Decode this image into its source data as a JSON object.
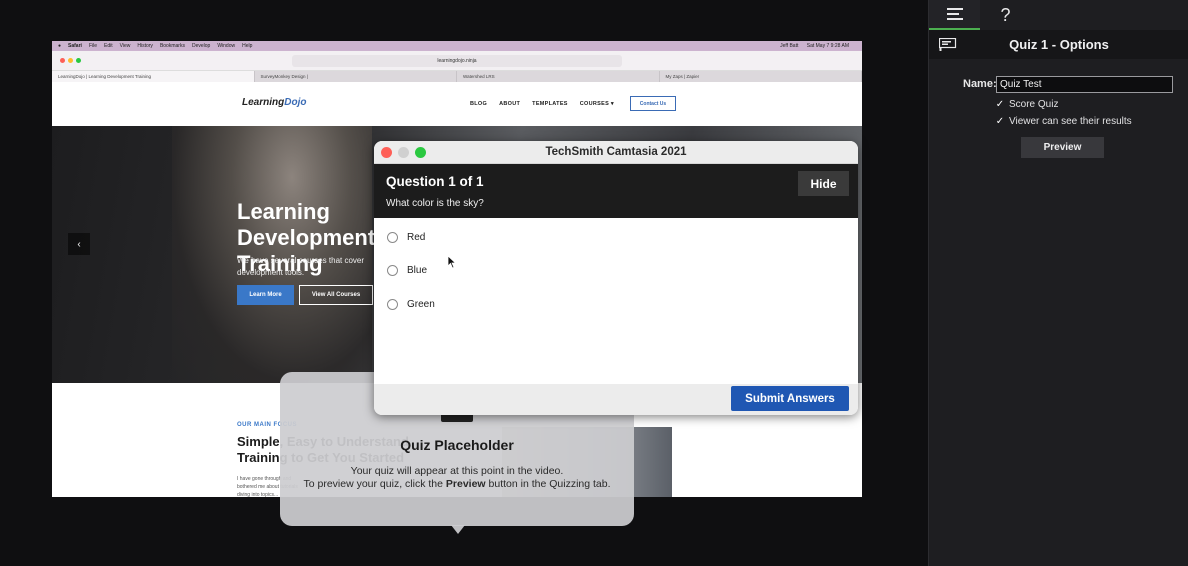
{
  "props_panel": {
    "tabs": [
      {
        "name": "properties",
        "glyph": "≡"
      },
      {
        "name": "help",
        "glyph": "?"
      }
    ],
    "header_title": "Quiz 1 - Options",
    "name_label": "Name:",
    "name_value": "Quiz Test",
    "checkboxes": [
      {
        "label": "Score Quiz",
        "checked": true
      },
      {
        "label": "Viewer can see their results",
        "checked": true
      }
    ],
    "preview_label": "Preview"
  },
  "browser": {
    "menubar": [
      "Safari",
      "File",
      "Edit",
      "View",
      "History",
      "Bookmarks",
      "Develop",
      "Window",
      "Help"
    ],
    "clock": "Sat May 7  9:28 AM",
    "user": "Jeff Batt",
    "address": "learningdojo.ninja",
    "tabs": [
      "LearningDojo | Learning Development Training",
      "SurveyMonkey Design |",
      "Watershed LRS",
      "My Zaps | Zapier"
    ]
  },
  "website": {
    "logo_text": "Learning",
    "logo_accent": "Dojo",
    "nav": [
      "BLOG",
      "ABOUT",
      "TEMPLATES",
      "COURSES ▾"
    ],
    "contact": "Contact Us",
    "hero_title": "Learning Development Training",
    "hero_sub": "We have several courses that cover development tools.",
    "btn_learn": "Learn More",
    "btn_courses": "View All Courses",
    "focus_label": "OUR MAIN FOCUS",
    "focus_title": "Simple, Easy to Understand Training to Get You Started",
    "focus_body": "I have gone through and bothered me about tutorials diving into topics..."
  },
  "placeholder": {
    "title": "Quiz Placeholder",
    "line1": "Your quiz will appear at this point in the video.",
    "line2_pre": "To preview your quiz, click the ",
    "line2_bold": "Preview",
    "line2_post": " button in the Quizzing tab."
  },
  "dialog": {
    "window_title": "TechSmith Camtasia 2021",
    "question_count": "Question 1 of 1",
    "question_text": "What color is the sky?",
    "hide_label": "Hide",
    "answers": [
      "Red",
      "Blue",
      "Green"
    ],
    "submit_label": "Submit Answers"
  },
  "colors": {
    "accent_green": "#4caf50",
    "submit_blue": "#1f57b3",
    "close_red": "#fe5f57",
    "minimize_gray": "#d0d0d0",
    "zoom_green": "#2ac840"
  }
}
